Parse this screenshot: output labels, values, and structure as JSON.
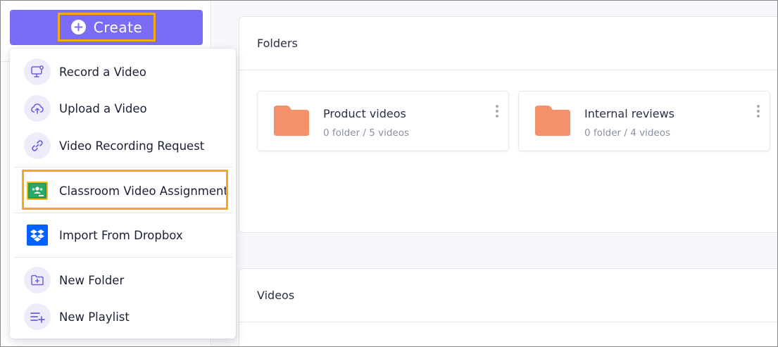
{
  "create_button": {
    "label": "Create"
  },
  "menu": {
    "items": [
      {
        "label": "Record a Video",
        "icon": "monitor-record-icon"
      },
      {
        "label": "Upload a Video",
        "icon": "cloud-upload-icon"
      },
      {
        "label": "Video Recording Request",
        "icon": "link-icon"
      },
      {
        "label": "Classroom Video Assignment",
        "icon": "google-classroom-icon"
      },
      {
        "label": "Import From Dropbox",
        "icon": "dropbox-icon"
      },
      {
        "label": "New Folder",
        "icon": "folder-plus-icon"
      },
      {
        "label": "New Playlist",
        "icon": "playlist-add-icon"
      }
    ]
  },
  "folders_section": {
    "title": "Folders",
    "folders": [
      {
        "name": "Product videos",
        "meta": "0 folder / 5 videos"
      },
      {
        "name": "Internal reviews",
        "meta": "0 folder / 4 videos"
      }
    ]
  },
  "videos_section": {
    "title": "Videos"
  },
  "colors": {
    "accent": "#7b6cf6",
    "highlight": "#f4a81d",
    "folder": "#f4906a",
    "icon_bg": "#eeecfb",
    "icon_fg": "#6a5fe0",
    "classroom_green": "#1e9e57",
    "dropbox_blue": "#0061fe"
  }
}
